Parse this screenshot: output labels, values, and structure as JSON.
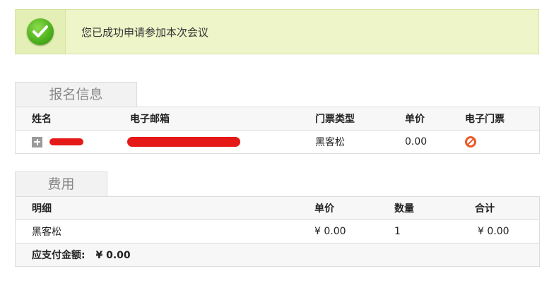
{
  "banner": {
    "message": "您已成功申请参加本次会议",
    "icon": "check-circle-icon"
  },
  "registration": {
    "tab_label": "报名信息",
    "columns": [
      "姓名",
      "电子邮箱",
      "门票类型",
      "单价",
      "电子门票"
    ],
    "rows": [
      {
        "name": "",
        "email": "",
        "ticket_type": "黑客松",
        "price": "0.00",
        "eticket_icon": "prohibited-icon"
      }
    ]
  },
  "fees": {
    "tab_label": "费用",
    "columns": [
      "明细",
      "单价",
      "数量",
      "合计"
    ],
    "rows": [
      {
        "item": "黑客松",
        "price": "¥ 0.00",
        "quantity": "1",
        "subtotal": "¥ 0.00"
      }
    ],
    "total_label": "应支付金额:",
    "total_value": "¥ 0.00"
  },
  "colors": {
    "banner_bg": "#eef5c8",
    "success_green": "#4fb31e",
    "redaction_red": "#e61919",
    "prohibited_orange": "#ea5a2a"
  }
}
